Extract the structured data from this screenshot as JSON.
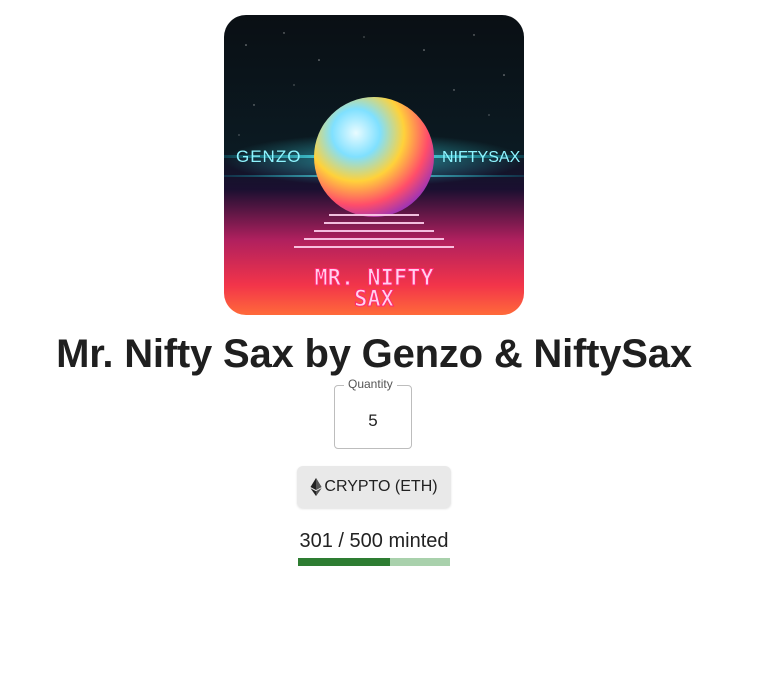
{
  "artwork": {
    "left_text": "GENZO",
    "right_text": "NIFTYSAX",
    "line1": "MR. NIFTY",
    "line2": "SAX"
  },
  "title": "Mr. Nifty Sax by Genzo & NiftySax",
  "quantity": {
    "label": "Quantity",
    "value": "5"
  },
  "pay_button": {
    "icon": "ethereum-icon",
    "label": "CRYPTO (ETH)"
  },
  "mint": {
    "text": "301 / 500 minted",
    "minted": 301,
    "total": 500
  },
  "colors": {
    "progress_fill": "#2e7d32",
    "progress_track": "#a9d1ac",
    "button_bg": "#e9e9e9"
  }
}
